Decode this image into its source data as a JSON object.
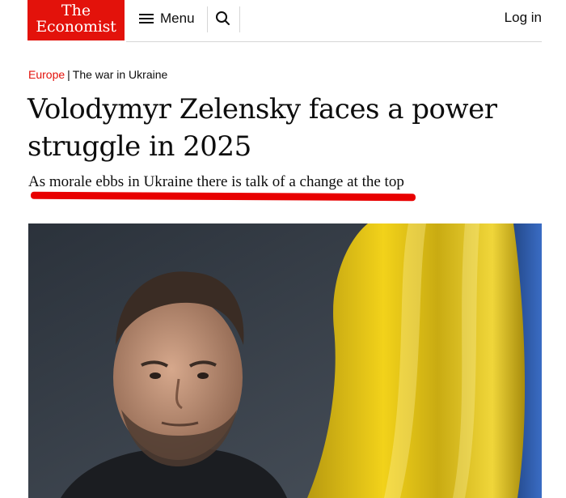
{
  "header": {
    "logo": {
      "line1": "The",
      "line2": "Economist"
    },
    "menu_label": "Menu",
    "login_label": "Log in"
  },
  "article": {
    "breadcrumb": {
      "section": "Europe",
      "divider": "|",
      "topic": "The war in Ukraine"
    },
    "headline_line1": "Volodymyr Zelensky faces a power",
    "headline_line2": "struggle in 2025",
    "standfirst": "As morale ebbs in Ukraine there is talk of a change at the top"
  },
  "colors": {
    "brand_red": "#e3120b",
    "annotation_red": "#e80000",
    "flag_yellow": "#f2d21a",
    "flag_blue": "#2f5fb3"
  },
  "icons": [
    "hamburger-icon",
    "search-icon"
  ]
}
